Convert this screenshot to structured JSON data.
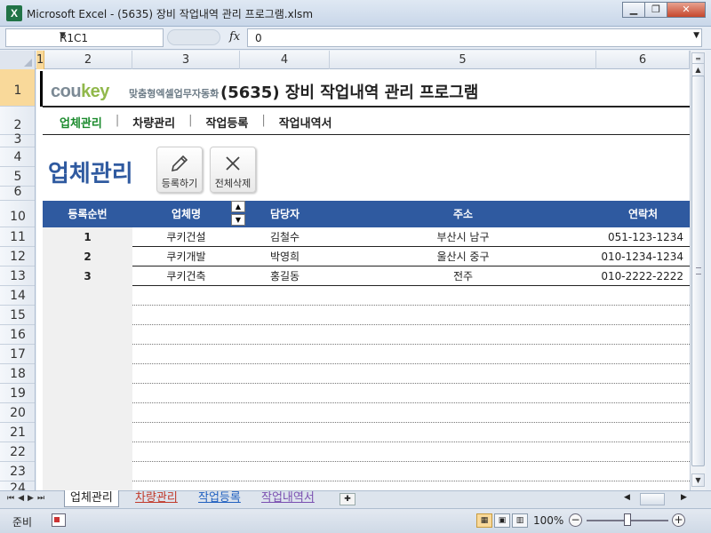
{
  "window": {
    "title": "Microsoft Excel - (5635) 장비 작업내역 관리 프로그램.xlsm",
    "app_icon": "X",
    "buttons": {
      "minimize": "▁",
      "restore": "❐",
      "close": "✕"
    }
  },
  "formula_bar": {
    "name_box": "R1C1",
    "fx_label": "fx",
    "value": "0"
  },
  "columns": [
    "1",
    "2",
    "3",
    "4",
    "5",
    "6"
  ],
  "rows": [
    "1",
    "2",
    "3",
    "4",
    "5",
    "6",
    "10",
    "11",
    "12",
    "13",
    "14",
    "15",
    "16",
    "17",
    "18",
    "19",
    "20",
    "21",
    "22",
    "23",
    "24"
  ],
  "header": {
    "brand_prefix": "cou",
    "brand_suffix": "key",
    "brand_sub": "맞춤형엑셀업무자동화",
    "title": "(5635) 장비 작업내역 관리 프로그램"
  },
  "nav": {
    "items": [
      "업체관리",
      "차량관리",
      "작업등록",
      "작업내역서"
    ],
    "separator": "|"
  },
  "page": {
    "heading": "업체관리",
    "register_label": "등록하기",
    "delete_all_label": "전체삭제"
  },
  "table": {
    "headers": [
      "등록순번",
      "업체명",
      "담당자",
      "주소",
      "연락처"
    ],
    "sort_up": "▲",
    "sort_down": "▼",
    "rows": [
      [
        "1",
        "쿠키건설",
        "김철수",
        "부산시 남구",
        "051-123-1234"
      ],
      [
        "2",
        "쿠키개발",
        "박영희",
        "울산시 중구",
        "010-1234-1234"
      ],
      [
        "3",
        "쿠키건축",
        "홍길동",
        "전주",
        "010-2222-2222"
      ]
    ]
  },
  "sheet_tabs": [
    "업체관리",
    "차량관리",
    "작업등록",
    "작업내역서"
  ],
  "status": {
    "ready": "준비",
    "zoom": "100%"
  },
  "colors": {
    "table_header": "#2f5aa0",
    "active_nav": "#1a8a2c",
    "heading": "#2f5aa0"
  }
}
